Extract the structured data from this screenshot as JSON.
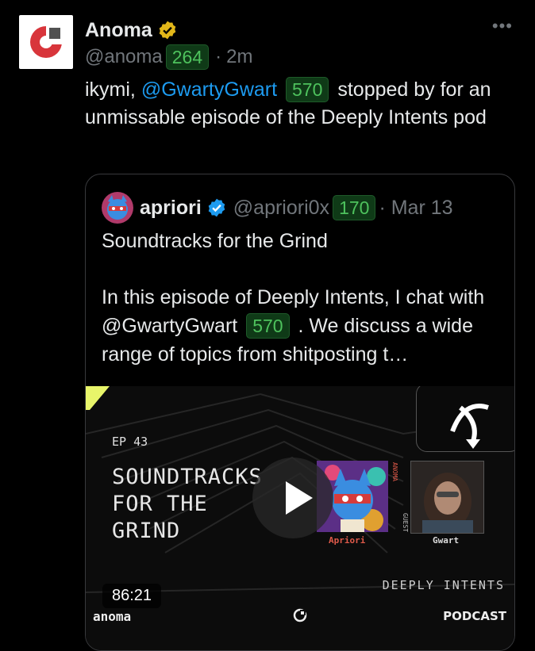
{
  "author": {
    "name": "Anoma",
    "handle": "@anoma",
    "follower_badge": "264",
    "time": "2m",
    "avatar_icon": "anoma-logo-icon",
    "verified_icon": "gold-verified-badge-icon"
  },
  "menu": {
    "more_label": "•••"
  },
  "tweet": {
    "text_before": "ikymi, ",
    "mention": "@GwartyGwart",
    "mention_badge": "570",
    "text_after": " stopped by for an unmissable episode of the Deeply Intents pod"
  },
  "quote": {
    "name": "apriori",
    "handle": "@apriori0x",
    "handle_badge": "170",
    "date": "Mar 13",
    "title": "Soundtracks for the Grind",
    "body_before": "In this episode of Deeply Intents, I chat with ",
    "body_mention": "@GwartyGwart",
    "body_mention_badge": "570",
    "body_after": ". We discuss a wide range of topics from shitposting t…"
  },
  "media": {
    "brand": "DEEPLY INTENTS",
    "episode": "EP 43",
    "title_lines": [
      "SOUNDTRACKS",
      "FOR THE",
      "GRIND"
    ],
    "host_name": "Apriori",
    "host_label": "ANOMA",
    "guest_name": "Gwart",
    "guest_label": "GUEST",
    "duration": "86:21",
    "footer_left": "anoma",
    "footer_right": "PODCAST"
  },
  "colors": {
    "background": "#000000",
    "text": "#e7e9ea",
    "muted": "#71767b",
    "link": "#1d9bf0",
    "badge_bg": "#0f3a17",
    "badge_fg": "#4ec25d"
  }
}
